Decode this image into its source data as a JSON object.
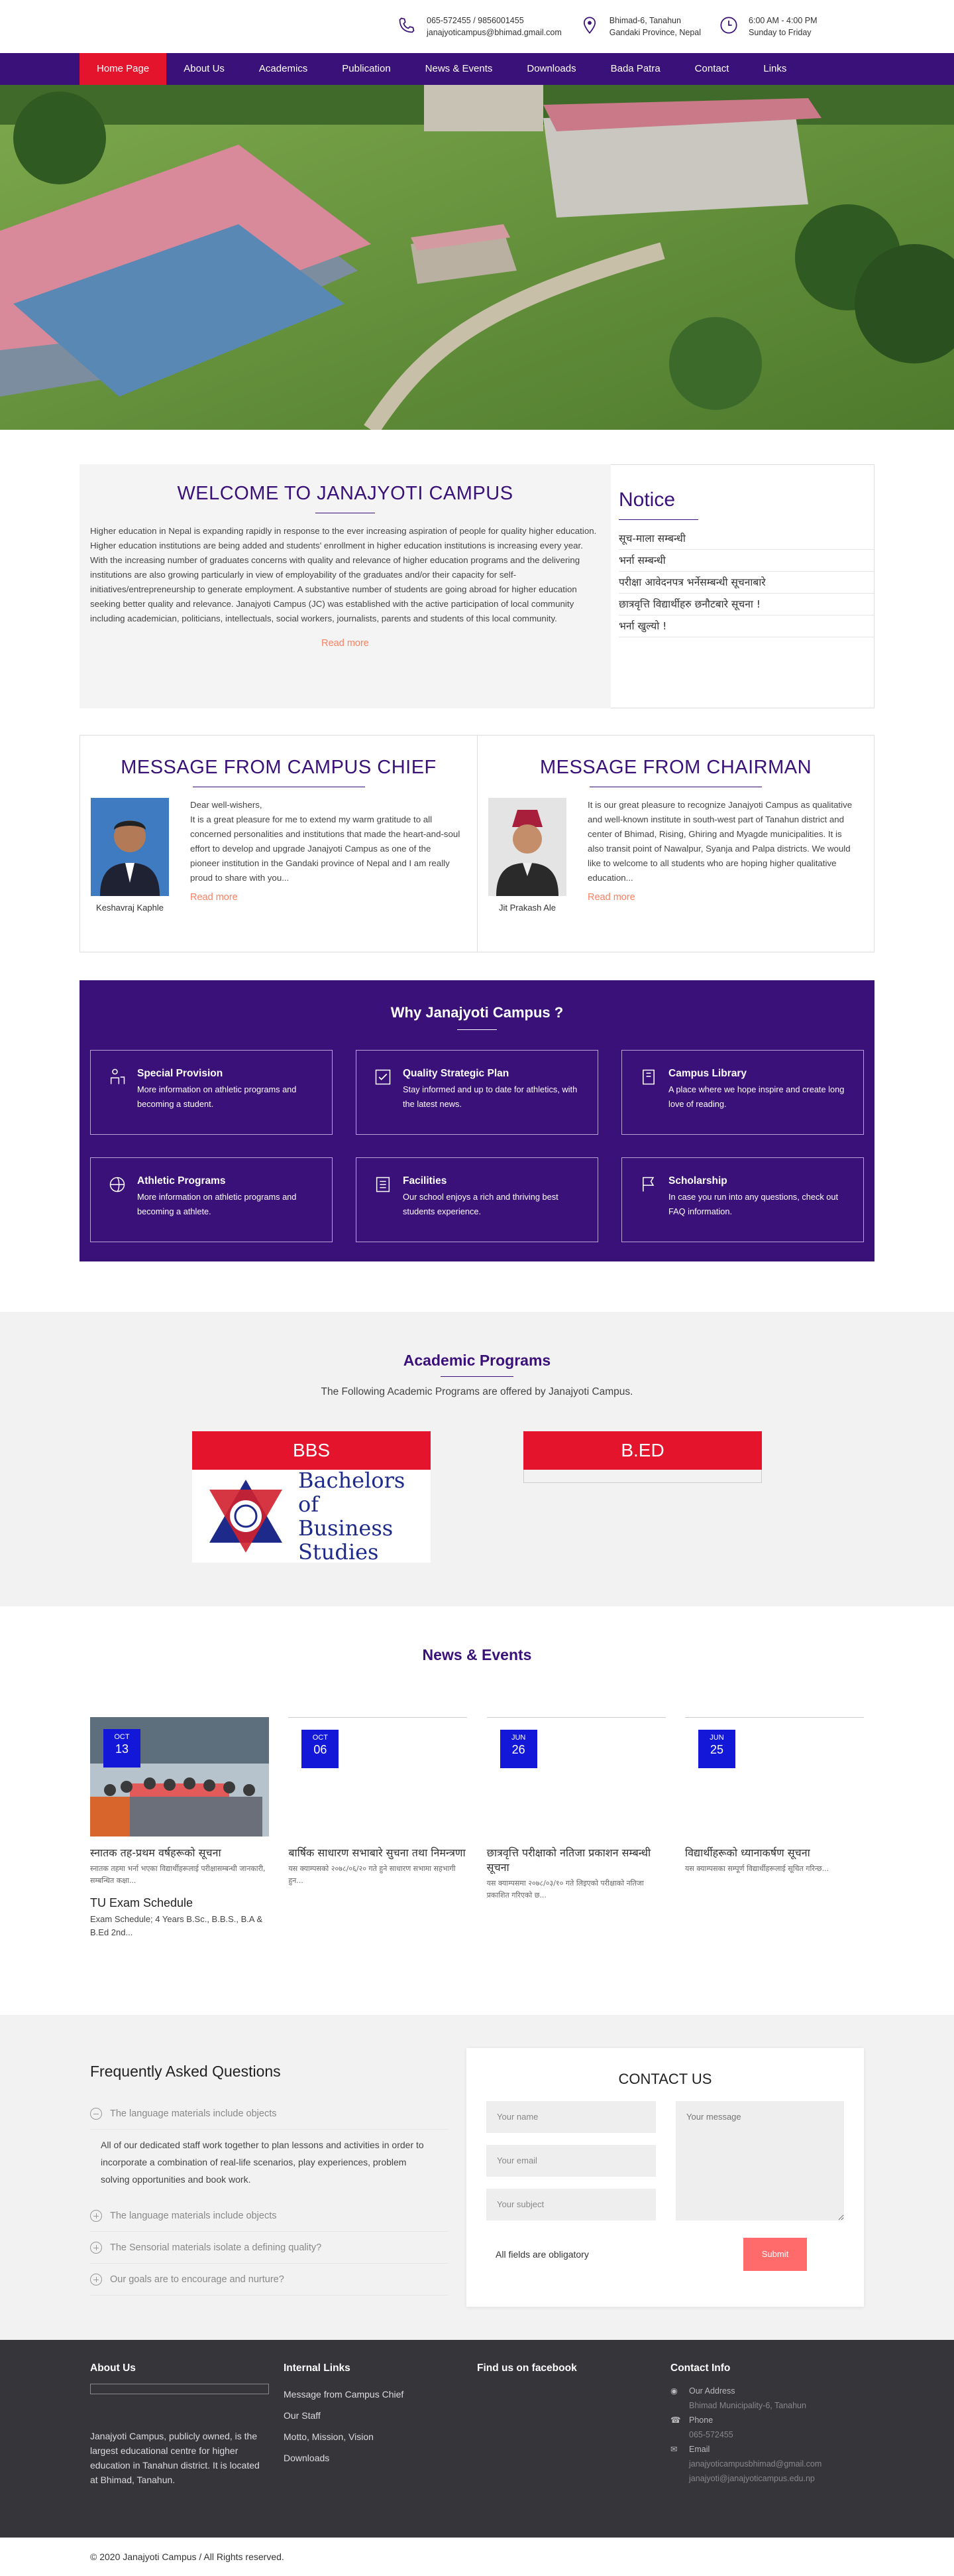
{
  "contact_top": [
    {
      "icon": "phone-icon",
      "lines": [
        "065-572455 / 9856001455",
        "janajyoticampus@bhimad.gmail.com"
      ]
    },
    {
      "icon": "location-pin-icon",
      "lines": [
        "Bhimad-6, Tanahun",
        "Gandaki Province, Nepal"
      ]
    },
    {
      "icon": "clock-icon",
      "lines": [
        "6:00 AM - 4:00 PM",
        "Sunday to Friday"
      ]
    }
  ],
  "nav": [
    "Home Page",
    "About Us",
    "Academics",
    "Publication",
    "News & Events",
    "Downloads",
    "Bada Patra",
    "Contact",
    "Links"
  ],
  "welcome": {
    "title": "WELCOME TO JANAJYOTI CAMPUS",
    "text": "Higher education in Nepal is expanding rapidly in response to the ever increasing aspiration of people for quality higher education.  Higher education institutions are being added and students' enrollment in higher education institutions is increasing every year.  With the increasing number of graduates concerns with quality and relevance of higher education programs and the delivering institutions are also growing particularly in view of employability of the graduates and/or their capacity for self-initiatives/entrepreneurship to generate employment.  A substantive number of students are going abroad for higher education seeking better quality and relevance. Janajyoti Campus (JC) was established with the active participation of local community including academician, politicians, intellectuals, social workers, journalists, parents and students of this local community.",
    "read_more": "Read more"
  },
  "notice": {
    "title": "Notice",
    "items": [
      "सूच-माला सम्बन्धी",
      "भर्ना सम्बन्धी",
      "परीक्षा आवेदनपत्र भर्नेसम्बन्धी सूचनाबारे",
      "छात्रवृत्ति विद्यार्थीहरु छनौटबारे सूचना !",
      "भर्ना खुल्यो !"
    ]
  },
  "chief": {
    "title": "MESSAGE FROM CAMPUS CHIEF",
    "name": "Keshavraj Kaphle",
    "text": "Dear well-wishers,\nIt is a great pleasure for me to extend my warm gratitude to all concerned personalities and institutions that made the heart-and-soul effort to develop and upgrade Janajyoti Campus as one of the pioneer institution in the Gandaki province of Nepal and I am really proud to share with you...",
    "read_more": "Read more"
  },
  "chairman": {
    "title": "MESSAGE FROM CHAIRMAN",
    "name": "Jit Prakash Ale",
    "text": "It is our great pleasure to recognize Janajyoti Campus as qualitative and well-known institute in south-west part of Tanahun district and center of Bhimad, Rising, Ghiring and Myagde municipalities. It is also transit point of Nawalpur, Syanja and Palpa districts. We would like to welcome to all students who are hoping higher qualitative education...",
    "read_more": "Read more"
  },
  "why": {
    "title": "Why Janajyoti Campus ?",
    "cards": [
      {
        "icon": "provision-icon",
        "title": "Special Provision",
        "text": "More information on athletic programs and becoming a student."
      },
      {
        "icon": "checklist-icon",
        "title": "Quality Strategic Plan",
        "text": "Stay informed and up to date for athletics, with the latest news."
      },
      {
        "icon": "library-icon",
        "title": "Campus Library",
        "text": "A place where we hope inspire and create long love of reading."
      },
      {
        "icon": "athletics-icon",
        "title": "Athletic Programs",
        "text": "More information on athletic programs and becoming a athlete."
      },
      {
        "icon": "facilities-icon",
        "title": "Facilities",
        "text": "Our school enjoys a rich and thriving best students experience."
      },
      {
        "icon": "flag-icon",
        "title": "Scholarship",
        "text": "In case you run into any questions, check out FAQ information."
      }
    ]
  },
  "academic": {
    "title": "Academic Programs",
    "subtitle": "The Following Academic Programs are offered by Janajyoti Campus.",
    "programs": [
      {
        "label": "BBS",
        "caption": "Bachelors of Business Studies"
      },
      {
        "label": "B.ED",
        "caption": ""
      }
    ]
  },
  "news": {
    "title": "News & Events",
    "items": [
      {
        "month": "OCT",
        "day": "13",
        "title": "स्नातक तह-प्रथम वर्षहरूको सूचना",
        "excerpt": "स्नातक तहमा भर्ना भएका विद्यार्थीहरूलाई परीक्षासम्बन्धी जानकारी, सम्बन्धित कक्षा...",
        "extra_title": "TU Exam Schedule",
        "extra_text": "Exam Schedule; 4 Years B.Sc., B.B.S., B.A & B.Ed 2nd..."
      },
      {
        "month": "OCT",
        "day": "06",
        "title": "बार्षिक साधारण सभाबारे सुचना तथा निमन्त्रणा",
        "excerpt": "यस क्याम्पसको २०७८/०६/२० गते हुने साधारण सभामा सहभागी हुन...",
        "extra_title": "",
        "extra_text": ""
      },
      {
        "month": "JUN",
        "day": "26",
        "title": "छात्रवृत्ति परीक्षाको नतिजा प्रकाशन सम्बन्धी सूचना",
        "excerpt": "यस क्याम्पसमा २०७८/०३/१० गते लिइएको परीक्षाको नतिजा प्रकाशित गरिएको छ...",
        "extra_title": "",
        "extra_text": ""
      },
      {
        "month": "JUN",
        "day": "25",
        "title": "विद्यार्थीहरूको ध्यानाकर्षण सूचना",
        "excerpt": "यस क्याम्पसका सम्पूर्ण विद्यार्थीहरूलाई सूचित गरिन्छ...",
        "extra_title": "",
        "extra_text": ""
      }
    ]
  },
  "faq": {
    "title": "Frequently Asked Questions",
    "open_q": "The language materials include objects",
    "open_a": "All of our dedicated staff work together to plan lessons and activities in order to incorporate a combination of real-life scenarios, play experiences, problem solving opportunities and book work.",
    "questions": [
      "The language materials include objects",
      "The Sensorial materials isolate a defining quality?",
      "Our goals are to encourage and nurture?"
    ]
  },
  "contact": {
    "title": "CONTACT US",
    "name": "Your name",
    "email": "Your email",
    "subject": "Your subject",
    "message": "Your message",
    "note": "All fields are obligatory",
    "submit": "Submit"
  },
  "footer": {
    "about_title": "About Us",
    "about_text": "Janajyoti Campus, publicly owned, is the largest educational centre for higher education in Tanahun district. It is located at Bhimad, Tanahun.",
    "links_title": "Internal Links",
    "links": [
      "Message from Campus Chief",
      "Our Staff",
      "Motto, Mission, Vision",
      "Downloads"
    ],
    "fb_title": "Find us on facebook",
    "info_title": "Contact Info",
    "address_label": "Our Address",
    "address": "Bhimad Municipality-6, Tanahun",
    "phone_label": "Phone",
    "phone": "065-572455",
    "email_label": "Email",
    "email1": "janajyoticampusbhimad@gmail.com",
    "email2": "janajyoti@janajyoticampus.edu.np"
  },
  "copyright": "© 2020 Janajyoti Campus / All Rights reserved."
}
